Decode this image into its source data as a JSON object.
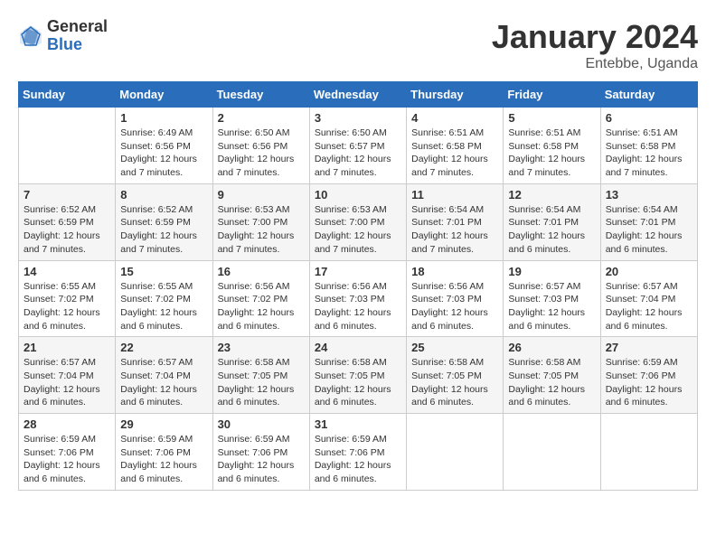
{
  "logo": {
    "general": "General",
    "blue": "Blue"
  },
  "title": "January 2024",
  "location": "Entebbe, Uganda",
  "days_of_week": [
    "Sunday",
    "Monday",
    "Tuesday",
    "Wednesday",
    "Thursday",
    "Friday",
    "Saturday"
  ],
  "weeks": [
    [
      {
        "day": "",
        "info": ""
      },
      {
        "day": "1",
        "info": "Sunrise: 6:49 AM\nSunset: 6:56 PM\nDaylight: 12 hours\nand 7 minutes."
      },
      {
        "day": "2",
        "info": "Sunrise: 6:50 AM\nSunset: 6:56 PM\nDaylight: 12 hours\nand 7 minutes."
      },
      {
        "day": "3",
        "info": "Sunrise: 6:50 AM\nSunset: 6:57 PM\nDaylight: 12 hours\nand 7 minutes."
      },
      {
        "day": "4",
        "info": "Sunrise: 6:51 AM\nSunset: 6:58 PM\nDaylight: 12 hours\nand 7 minutes."
      },
      {
        "day": "5",
        "info": "Sunrise: 6:51 AM\nSunset: 6:58 PM\nDaylight: 12 hours\nand 7 minutes."
      },
      {
        "day": "6",
        "info": "Sunrise: 6:51 AM\nSunset: 6:58 PM\nDaylight: 12 hours\nand 7 minutes."
      }
    ],
    [
      {
        "day": "7",
        "info": "Sunrise: 6:52 AM\nSunset: 6:59 PM\nDaylight: 12 hours\nand 7 minutes."
      },
      {
        "day": "8",
        "info": "Sunrise: 6:52 AM\nSunset: 6:59 PM\nDaylight: 12 hours\nand 7 minutes."
      },
      {
        "day": "9",
        "info": "Sunrise: 6:53 AM\nSunset: 7:00 PM\nDaylight: 12 hours\nand 7 minutes."
      },
      {
        "day": "10",
        "info": "Sunrise: 6:53 AM\nSunset: 7:00 PM\nDaylight: 12 hours\nand 7 minutes."
      },
      {
        "day": "11",
        "info": "Sunrise: 6:54 AM\nSunset: 7:01 PM\nDaylight: 12 hours\nand 7 minutes."
      },
      {
        "day": "12",
        "info": "Sunrise: 6:54 AM\nSunset: 7:01 PM\nDaylight: 12 hours\nand 6 minutes."
      },
      {
        "day": "13",
        "info": "Sunrise: 6:54 AM\nSunset: 7:01 PM\nDaylight: 12 hours\nand 6 minutes."
      }
    ],
    [
      {
        "day": "14",
        "info": "Sunrise: 6:55 AM\nSunset: 7:02 PM\nDaylight: 12 hours\nand 6 minutes."
      },
      {
        "day": "15",
        "info": "Sunrise: 6:55 AM\nSunset: 7:02 PM\nDaylight: 12 hours\nand 6 minutes."
      },
      {
        "day": "16",
        "info": "Sunrise: 6:56 AM\nSunset: 7:02 PM\nDaylight: 12 hours\nand 6 minutes."
      },
      {
        "day": "17",
        "info": "Sunrise: 6:56 AM\nSunset: 7:03 PM\nDaylight: 12 hours\nand 6 minutes."
      },
      {
        "day": "18",
        "info": "Sunrise: 6:56 AM\nSunset: 7:03 PM\nDaylight: 12 hours\nand 6 minutes."
      },
      {
        "day": "19",
        "info": "Sunrise: 6:57 AM\nSunset: 7:03 PM\nDaylight: 12 hours\nand 6 minutes."
      },
      {
        "day": "20",
        "info": "Sunrise: 6:57 AM\nSunset: 7:04 PM\nDaylight: 12 hours\nand 6 minutes."
      }
    ],
    [
      {
        "day": "21",
        "info": "Sunrise: 6:57 AM\nSunset: 7:04 PM\nDaylight: 12 hours\nand 6 minutes."
      },
      {
        "day": "22",
        "info": "Sunrise: 6:57 AM\nSunset: 7:04 PM\nDaylight: 12 hours\nand 6 minutes."
      },
      {
        "day": "23",
        "info": "Sunrise: 6:58 AM\nSunset: 7:05 PM\nDaylight: 12 hours\nand 6 minutes."
      },
      {
        "day": "24",
        "info": "Sunrise: 6:58 AM\nSunset: 7:05 PM\nDaylight: 12 hours\nand 6 minutes."
      },
      {
        "day": "25",
        "info": "Sunrise: 6:58 AM\nSunset: 7:05 PM\nDaylight: 12 hours\nand 6 minutes."
      },
      {
        "day": "26",
        "info": "Sunrise: 6:58 AM\nSunset: 7:05 PM\nDaylight: 12 hours\nand 6 minutes."
      },
      {
        "day": "27",
        "info": "Sunrise: 6:59 AM\nSunset: 7:06 PM\nDaylight: 12 hours\nand 6 minutes."
      }
    ],
    [
      {
        "day": "28",
        "info": "Sunrise: 6:59 AM\nSunset: 7:06 PM\nDaylight: 12 hours\nand 6 minutes."
      },
      {
        "day": "29",
        "info": "Sunrise: 6:59 AM\nSunset: 7:06 PM\nDaylight: 12 hours\nand 6 minutes."
      },
      {
        "day": "30",
        "info": "Sunrise: 6:59 AM\nSunset: 7:06 PM\nDaylight: 12 hours\nand 6 minutes."
      },
      {
        "day": "31",
        "info": "Sunrise: 6:59 AM\nSunset: 7:06 PM\nDaylight: 12 hours\nand 6 minutes."
      },
      {
        "day": "",
        "info": ""
      },
      {
        "day": "",
        "info": ""
      },
      {
        "day": "",
        "info": ""
      }
    ]
  ]
}
